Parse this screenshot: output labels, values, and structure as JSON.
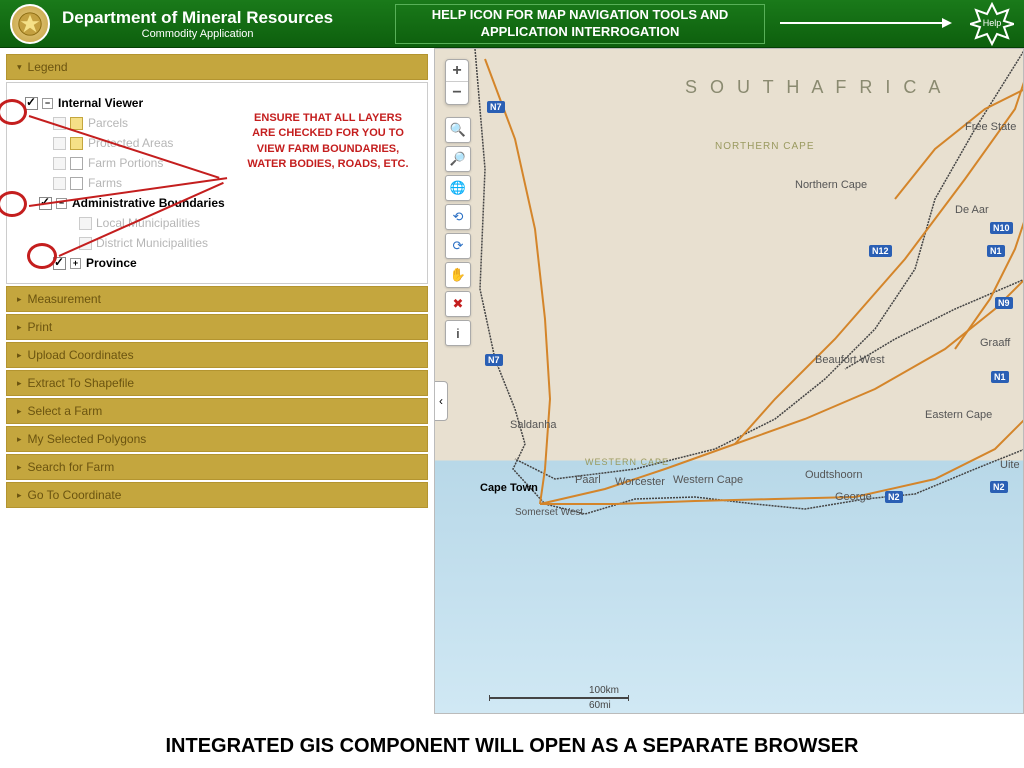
{
  "header": {
    "dept_title": "Department of Mineral Resources",
    "dept_subtitle": "Commodity Application",
    "help_banner": "HELP ICON FOR MAP NAVIGATION TOOLS AND APPLICATION INTERROGATION",
    "help_label": "Help"
  },
  "sidebar": {
    "legend_label": "Legend",
    "note": "ENSURE THAT ALL LAYERS ARE CHECKED FOR YOU TO VIEW FARM BOUNDARIES, WATER BODIES, ROADS, ETC.",
    "layers": {
      "internal_viewer": "Internal Viewer",
      "parcels": "Parcels",
      "protected_areas": "Protected Areas",
      "farm_portions": "Farm Portions",
      "farms": "Farms",
      "admin_boundaries": "Administrative Boundaries",
      "local_muni": "Local Municipalities",
      "district_muni": "District Municipalities",
      "province": "Province"
    },
    "panels": [
      "Measurement",
      "Print",
      "Upload Coordinates",
      "Extract To Shapefile",
      "Select a Farm",
      "My Selected Polygons",
      "Search for Farm",
      "Go To Coordinate"
    ]
  },
  "map": {
    "country": "S O U T H   A F R I C A",
    "labels": {
      "northern_cape_region": "NORTHERN CAPE",
      "northern_cape": "Northern Cape",
      "western_cape_region": "WESTERN CAPE",
      "western_cape": "Western Cape",
      "free_state": "Free State",
      "de_aar": "De Aar",
      "beaufort_west": "Beaufort West",
      "graaff": "Graaff",
      "eastern_cape": "Eastern Cape",
      "saldanha": "Saldanha",
      "cape_town": "Cape Town",
      "paarl": "Paarl",
      "worcester": "Worcester",
      "oudtshoorn": "Oudtshoorn",
      "george": "George",
      "somerset_west": "Somerset West",
      "uite": "Uite"
    },
    "routes": {
      "n7": "N7",
      "n1": "N1",
      "n12": "N12",
      "n10": "N10",
      "n2": "N2",
      "n9": "N9"
    },
    "scale": {
      "km": "100km",
      "mi": "60mi"
    },
    "tools": [
      "zoom-in",
      "zoom-out",
      "globe",
      "zoom-prev",
      "zoom-next",
      "pan",
      "clear",
      "identify"
    ]
  },
  "footer": "INTEGRATED GIS COMPONENT WILL OPEN AS A SEPARATE BROWSER"
}
